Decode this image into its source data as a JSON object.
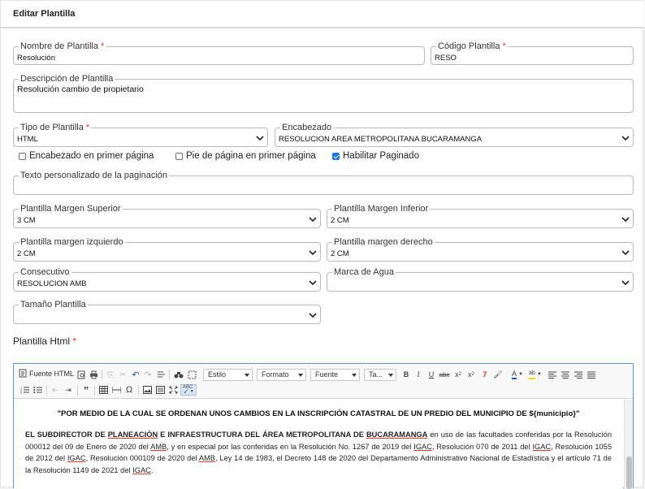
{
  "header": {
    "title": "Editar Plantilla"
  },
  "fields": {
    "nombre": {
      "label": "Nombre de Plantilla",
      "required": "*",
      "value": "Resolución"
    },
    "codigo": {
      "label": "Código Plantilla",
      "required": "*",
      "value": "RESO"
    },
    "descripcion": {
      "label": "Descripción de Plantilla",
      "value": "Resolución cambio de propietario"
    },
    "tipo": {
      "label": "Tipo de Plantilla",
      "required": "*",
      "value": "HTML"
    },
    "encabezado": {
      "label": "Encabezado",
      "value": "RESOLUCION AREA METROPOLITANA BUCARAMANGA"
    },
    "texto_paginacion": {
      "label": "Texto personalizado de la paginación",
      "value": ""
    },
    "margen_superior": {
      "label": "Plantilla Margen Superior",
      "value": "3 CM"
    },
    "margen_inferior": {
      "label": "Plantilla Margen Inferior",
      "value": "2 CM"
    },
    "margen_izquierdo": {
      "label": "Plantilla margen izquierdo",
      "value": "2 CM"
    },
    "margen_derecho": {
      "label": "Plantilla margen derecho",
      "value": "2 CM"
    },
    "consecutivo": {
      "label": "Consecutivo",
      "value": "RESOLUCION AMB"
    },
    "marca_agua": {
      "label": "Marca de Agua",
      "value": ""
    },
    "tamano": {
      "label": "Tamaño Plantilla",
      "value": ""
    }
  },
  "checkboxes": [
    {
      "label": "Encabezado en primer página",
      "checked": false
    },
    {
      "label": "Pie de página en primer página",
      "checked": false
    },
    {
      "label": "Habilitar Paginado",
      "checked": true
    }
  ],
  "editor": {
    "label": "Plantilla Html",
    "required": "*",
    "toolbar": {
      "source_label": "Fuente HTML",
      "style_label": "Estilo",
      "format_label": "Formato",
      "font_label": "Fuente",
      "size_label": "Ta..."
    },
    "content": {
      "title": "\"POR MEDIO DE LA CUAL SE ORDENAN UNOS CAMBIOS EN LA INSCRIPCIÓN CATASTRAL DE UN PREDIO DEL MUNICIPIO DE ${municipio}\"",
      "para_bold_1": "EL SUBDIRECTOR DE ",
      "para_bold_u1": "PLANEACIÓN",
      "para_bold_2": " E INFRAESTRUCTURA DEL ÁREA METROPOLITANA DE ",
      "para_bold_u2": "BUCARAMANGA",
      "para_t1": " en uso de las facultades conferidas por la Resolución 000012 del 09 de Enero de 2020 del ",
      "u_amb": "AMB",
      "para_t2": ", y en especial por las conferidas en la Resolución No. 1267 de 2019 del ",
      "u_igac": "IGAC",
      "para_t3": ", Resolución 070 de 2011 del ",
      "para_t4": ", Resolución 1055 de 2012 del ",
      "para_t5": ", Resolución 000109 de 2020 del ",
      "para_t6": ", Ley 14 de 1983, el Decreto 148 de 2020 del Departamento Administrativo Nacional de Estadística y el artículo 71 de la Resolución 1149 de 2021 del ",
      "para_t7": "."
    }
  },
  "colors": {
    "accent": "#1a73e8",
    "required": "#e53935",
    "editor_border": "#5b9bd5"
  }
}
